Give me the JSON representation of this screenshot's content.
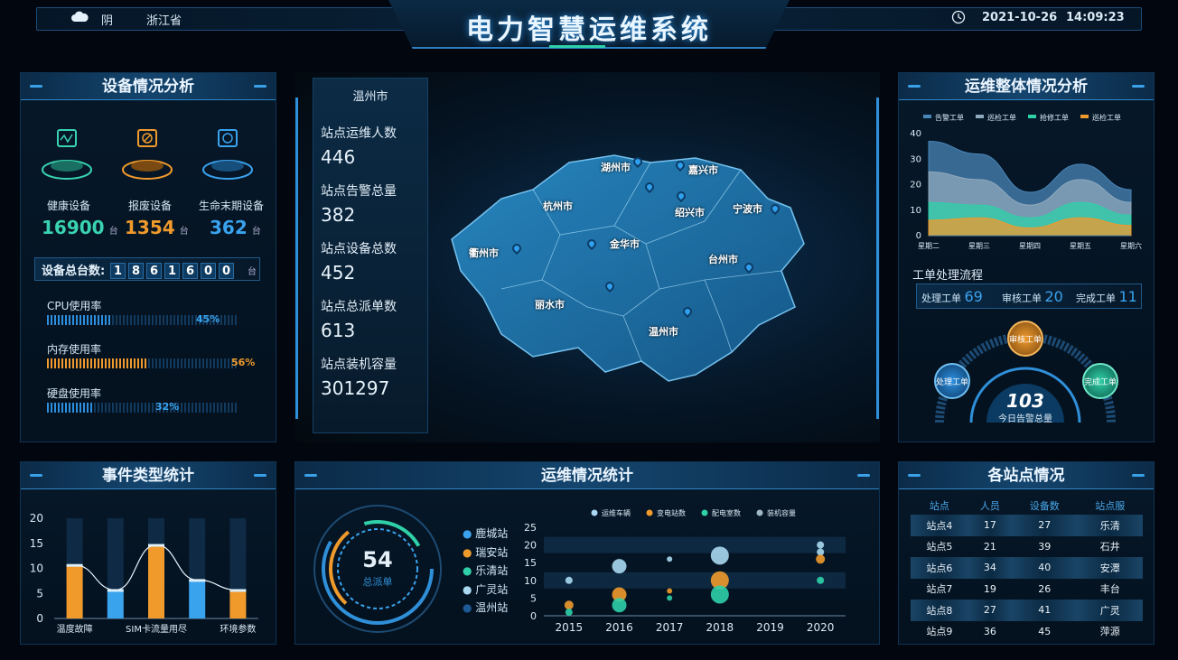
{
  "header": {
    "title": "电力智慧运维系统",
    "weather": "阴",
    "province": "浙江省",
    "date": "2021-10-26",
    "time": "14:09:23"
  },
  "device_panel": {
    "title": "设备情况分析",
    "cards": [
      {
        "label": "健康设备",
        "value": "16900",
        "unit": "台",
        "color": "#39d3b0"
      },
      {
        "label": "报废设备",
        "value": "1354",
        "unit": "台",
        "color": "#f09a2c"
      },
      {
        "label": "生命末期设备",
        "value": "362",
        "unit": "台",
        "color": "#3aa3ee"
      }
    ],
    "total_label": "设备总台数:",
    "total_digits": [
      "1",
      "8",
      "6",
      "1",
      "6",
      "0",
      "0"
    ],
    "total_unit": "台",
    "usage": [
      {
        "label": "CPU使用率",
        "value": 45,
        "text": "45%"
      },
      {
        "label": "内存使用率",
        "value": 56,
        "text": "56%"
      },
      {
        "label": "硬盘使用率",
        "value": 32,
        "text": "32%"
      }
    ]
  },
  "center_stats": {
    "city": "温州市",
    "items": [
      {
        "label": "站点运维人数",
        "value": "446"
      },
      {
        "label": "站点告警总量",
        "value": "382"
      },
      {
        "label": "站点设备总数",
        "value": "452"
      },
      {
        "label": "站点总派单数",
        "value": "613"
      },
      {
        "label": "站点装机容量",
        "value": "301297"
      }
    ]
  },
  "map": {
    "cities": [
      "湖州市",
      "嘉兴市",
      "杭州市",
      "绍兴市",
      "宁波市",
      "衢州市",
      "金华市",
      "台州市",
      "丽水市",
      "温州市"
    ]
  },
  "ops_panel": {
    "title": "运维整体情况分析",
    "workflow_title": "工单处理流程",
    "workflow": [
      {
        "label": "处理工单",
        "value": "69"
      },
      {
        "label": "审核工单",
        "value": "20"
      },
      {
        "label": "完成工单",
        "value": "11"
      }
    ],
    "gauge": {
      "value": "103",
      "label": "今日告警总量",
      "nodes": [
        "审核工单",
        "处理工单",
        "完成工单"
      ]
    }
  },
  "event_panel": {
    "title": "事件类型统计"
  },
  "stats_panel": {
    "title": "运维情况统计",
    "ring": {
      "value": "54",
      "label": "总派单"
    },
    "stations": [
      {
        "name": "鹿城站",
        "color": "#3aa3ee"
      },
      {
        "name": "瑞安站",
        "color": "#f09a2c"
      },
      {
        "name": "乐清站",
        "color": "#2fd0a8"
      },
      {
        "name": "广灵站",
        "color": "#a9d8f0"
      },
      {
        "name": "温州站",
        "color": "#1e5a96"
      }
    ]
  },
  "station_panel": {
    "title": "各站点情况",
    "columns": [
      "站点",
      "人员",
      "设备数",
      "站点服"
    ],
    "rows": [
      [
        "站点4",
        "17",
        "27",
        "乐清"
      ],
      [
        "站点5",
        "21",
        "39",
        "石井"
      ],
      [
        "站点6",
        "34",
        "40",
        "安潭"
      ],
      [
        "站点7",
        "19",
        "26",
        "丰台"
      ],
      [
        "站点8",
        "27",
        "41",
        "广灵"
      ],
      [
        "站点9",
        "36",
        "45",
        "萍源"
      ]
    ]
  },
  "chart_data": [
    {
      "type": "area",
      "legend": [
        "告警工单",
        "巡检工单",
        "抢修工单",
        "巡检工单"
      ],
      "categories": [
        "星期二",
        "星期三",
        "星期四",
        "星期五",
        "星期六"
      ],
      "ylim": [
        0,
        40
      ],
      "yticks": [
        0,
        10,
        20,
        30,
        40
      ],
      "series": [
        {
          "name": "告警工单",
          "color": "#4a86b8",
          "values": [
            37,
            32,
            17,
            28,
            18
          ]
        },
        {
          "name": "巡检工单",
          "color": "#8fa9bd",
          "values": [
            25,
            22,
            12,
            22,
            13
          ]
        },
        {
          "name": "抢修工单",
          "color": "#2fd0a8",
          "values": [
            13,
            12,
            7,
            13,
            8
          ]
        },
        {
          "name": "巡检工单",
          "color": "#f09a2c",
          "values": [
            6,
            7,
            3,
            7,
            4
          ]
        }
      ]
    },
    {
      "type": "bar",
      "categories": [
        "温度故障",
        "",
        "SIM卡流量用尽",
        "",
        "环境参数"
      ],
      "ylim": [
        0,
        20
      ],
      "yticks": [
        0,
        5,
        10,
        15,
        20
      ],
      "values": [
        10.5,
        5.5,
        14.5,
        7.5,
        5.5
      ],
      "bar_colors": [
        "#f09a2c",
        "#3aa3ee",
        "#f09a2c",
        "#3aa3ee",
        "#f09a2c"
      ]
    },
    {
      "type": "scatter",
      "legend": [
        "运维车辆",
        "变电站数",
        "配电室数",
        "装机容量"
      ],
      "legend_colors": [
        "#a9d8f0",
        "#f09a2c",
        "#2fd0a8",
        "#9fb6c6"
      ],
      "categories": [
        "2015",
        "2016",
        "2017",
        "2018",
        "2019",
        "2020"
      ],
      "ylim": [
        0,
        25
      ],
      "yticks": [
        0,
        5,
        10,
        15,
        20,
        25
      ],
      "points": [
        {
          "series": 0,
          "x": "2015",
          "y": 10,
          "size": 4
        },
        {
          "series": 1,
          "x": "2015",
          "y": 3,
          "size": 5
        },
        {
          "series": 2,
          "x": "2015",
          "y": 1,
          "size": 4
        },
        {
          "series": 0,
          "x": "2016",
          "y": 14,
          "size": 8
        },
        {
          "series": 1,
          "x": "2016",
          "y": 6,
          "size": 8
        },
        {
          "series": 2,
          "x": "2016",
          "y": 3,
          "size": 8
        },
        {
          "series": 0,
          "x": "2017",
          "y": 16,
          "size": 3
        },
        {
          "series": 1,
          "x": "2017",
          "y": 7,
          "size": 3
        },
        {
          "series": 2,
          "x": "2017",
          "y": 5,
          "size": 3
        },
        {
          "series": 0,
          "x": "2018",
          "y": 17,
          "size": 10
        },
        {
          "series": 1,
          "x": "2018",
          "y": 10,
          "size": 10
        },
        {
          "series": 2,
          "x": "2018",
          "y": 6,
          "size": 10
        },
        {
          "series": 0,
          "x": "2020",
          "y": 20,
          "size": 4
        },
        {
          "series": 0,
          "x": "2020",
          "y": 18,
          "size": 4
        },
        {
          "series": 1,
          "x": "2020",
          "y": 16,
          "size": 5
        },
        {
          "series": 2,
          "x": "2020",
          "y": 10,
          "size": 4
        }
      ]
    }
  ]
}
